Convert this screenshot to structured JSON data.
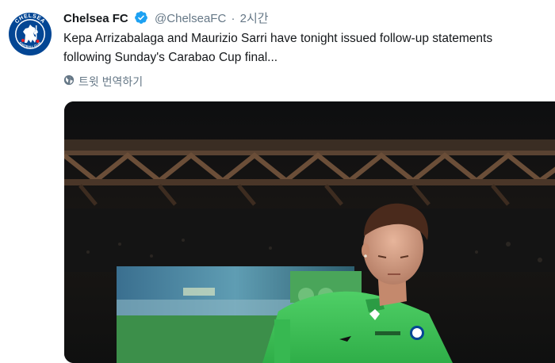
{
  "tweet": {
    "author_name": "Chelsea FC",
    "handle": "@ChelseaFC",
    "separator": "·",
    "time": "2시간",
    "text_line1": "Kepa Arrizabalaga and Maurizio Sarri have tonight issued follow-up statements",
    "text_line2": "following Sunday's Carabao Cup final...",
    "translate_label": "트윗 번역하기"
  },
  "avatar": {
    "logo_text_top": "CHELSEA",
    "logo_text_bottom": "FOOTBALL CLUB"
  },
  "icons": {
    "verified": "verified-badge-icon",
    "translate": "globe-icon"
  },
  "colors": {
    "verified": "#1da1f2",
    "chelsea_blue": "#034694",
    "kit_green": "#3fbf5a",
    "secondary_text": "#657786"
  }
}
